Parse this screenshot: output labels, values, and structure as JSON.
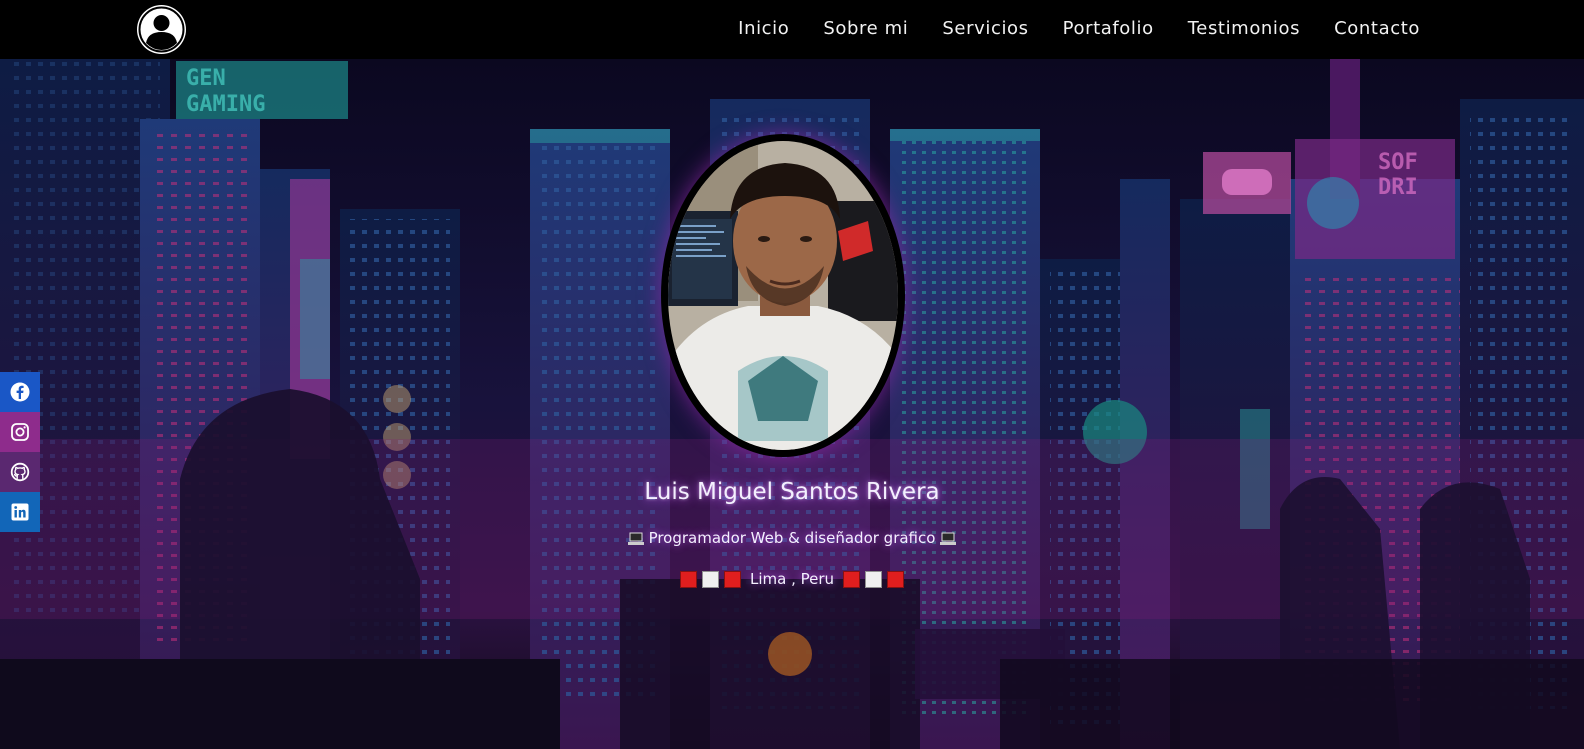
{
  "nav": {
    "links": [
      "Inicio",
      "Sobre mi",
      "Servicios",
      "Portafolio",
      "Testimonios",
      "Contacto"
    ]
  },
  "hero": {
    "name": "Luis Miguel Santos Rivera",
    "subtitle": "Programador Web & diseñador grafico",
    "location": "Lima , Peru",
    "background_signs": [
      "GEN",
      "GAMING",
      "SOF",
      "DRI"
    ]
  },
  "social": {
    "items": [
      "facebook-icon",
      "instagram-icon",
      "github-icon",
      "linkedin-icon"
    ]
  },
  "colors": {
    "nav_bg": "#000000",
    "flag_red": "#e01e1e",
    "flag_white": "#f0f0f0",
    "glow": "#c85aff"
  }
}
